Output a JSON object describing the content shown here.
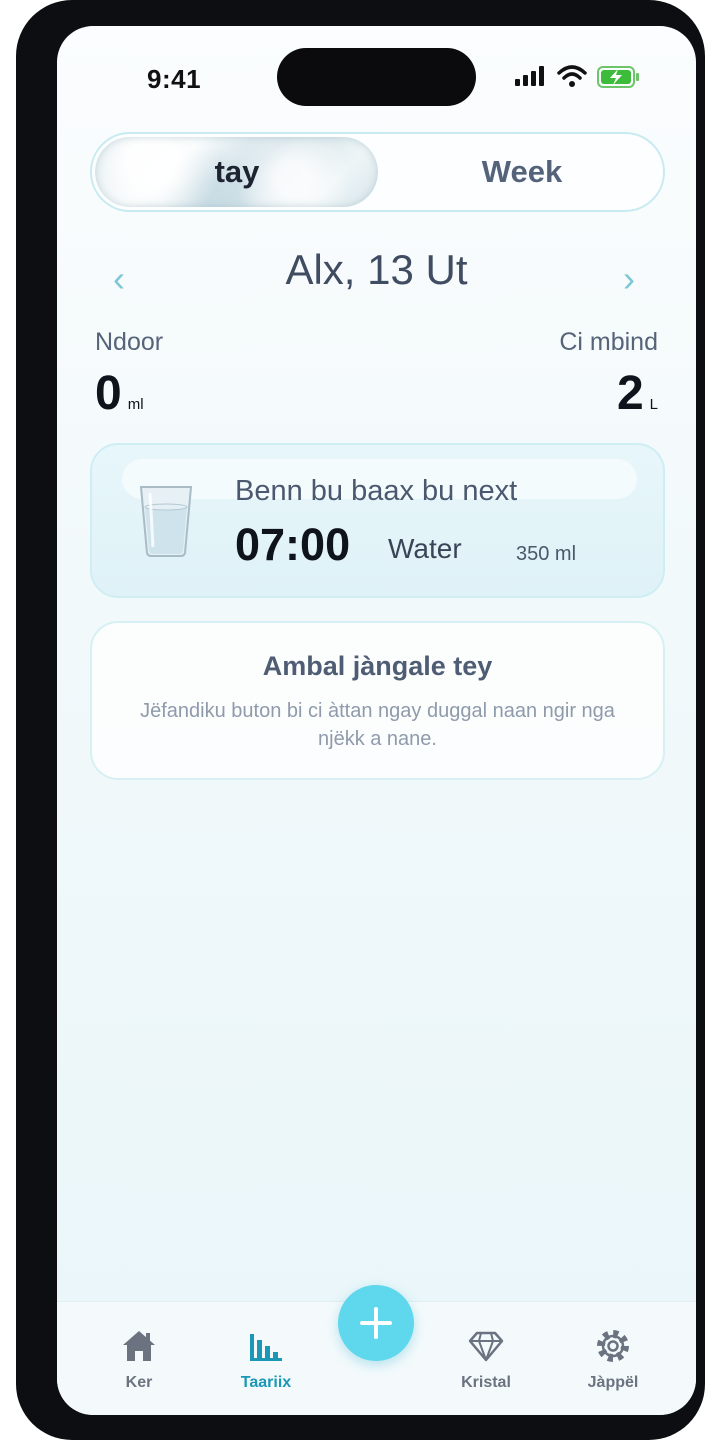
{
  "status": {
    "time": "9:41"
  },
  "segment": {
    "day": "tay",
    "week": "Week"
  },
  "date_nav": {
    "date": "Alx, 13 Ut",
    "prev": "‹",
    "next": "›"
  },
  "stats": {
    "left": {
      "label": "Ndoor",
      "value": "0",
      "unit": "ml"
    },
    "right": {
      "label": "Ci mbind",
      "value": "2",
      "unit": "L"
    }
  },
  "next_drink": {
    "title": "Benn bu baax bu next",
    "time": "07:00",
    "drink": "Water",
    "amount": "350 ml",
    "icon": "water-glass-icon"
  },
  "empty_state": {
    "title": "Ambal jàngale tey",
    "body": "Jëfandiku buton bi ci àttan ngay duggal naan ngir nga njëkk a nane."
  },
  "tabbar": {
    "home": "Ker",
    "history": "Taariix",
    "crystal": "Kristal",
    "settings": "Jàppël",
    "active": "history",
    "active_color": "#1a98b5",
    "fab_color": "#5fd7ec"
  }
}
